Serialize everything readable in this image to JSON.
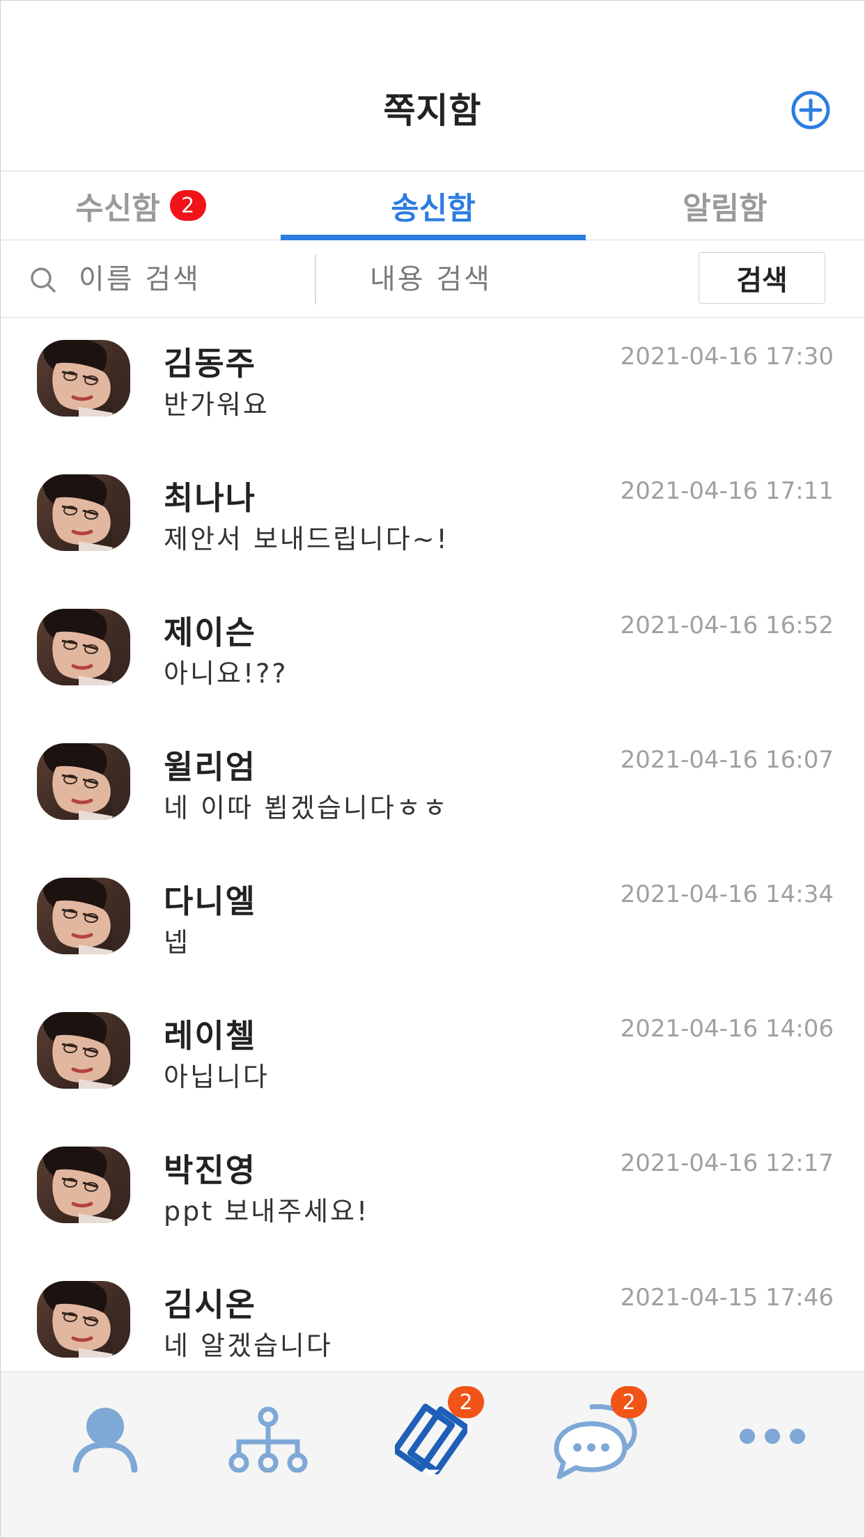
{
  "header": {
    "title": "쪽지함",
    "add_icon": "plus-circle-icon"
  },
  "tabs": [
    {
      "label": "수신함",
      "badge": "2",
      "active": false
    },
    {
      "label": "송신함",
      "active": true
    },
    {
      "label": "알림함",
      "active": false
    }
  ],
  "search": {
    "name_placeholder": "이름 검색",
    "content_placeholder": "내용 검색",
    "button_label": "검색"
  },
  "messages": [
    {
      "name": "김동주",
      "text": "반가워요",
      "time": "2021-04-16 17:30"
    },
    {
      "name": "최나나",
      "text": "제안서 보내드립니다~!",
      "time": "2021-04-16 17:11"
    },
    {
      "name": "제이슨",
      "text": "아니요!??",
      "time": "2021-04-16 16:52"
    },
    {
      "name": "윌리엄",
      "text": "네 이따 뵙겠습니다ㅎㅎ",
      "time": "2021-04-16 16:07"
    },
    {
      "name": "다니엘",
      "text": "넵",
      "time": "2021-04-16 14:34"
    },
    {
      "name": "레이첼",
      "text": "아닙니다",
      "time": "2021-04-16 14:06"
    },
    {
      "name": "박진영",
      "text": "ppt 보내주세요!",
      "time": "2021-04-16 12:17"
    },
    {
      "name": "김시온",
      "text": "네 알겠습니다",
      "time": "2021-04-15 17:46"
    }
  ],
  "nav": {
    "items": [
      {
        "icon": "person-icon"
      },
      {
        "icon": "org-chart-icon"
      },
      {
        "icon": "message-box-icon",
        "badge": "2",
        "active": true
      },
      {
        "icon": "chat-bubble-icon",
        "badge": "2"
      },
      {
        "icon": "more-icon"
      }
    ]
  },
  "colors": {
    "accent": "#2c7de0",
    "badge_red": "#f0141a",
    "badge_orange": "#f25418",
    "nav_icon": "#7ea8d6"
  }
}
